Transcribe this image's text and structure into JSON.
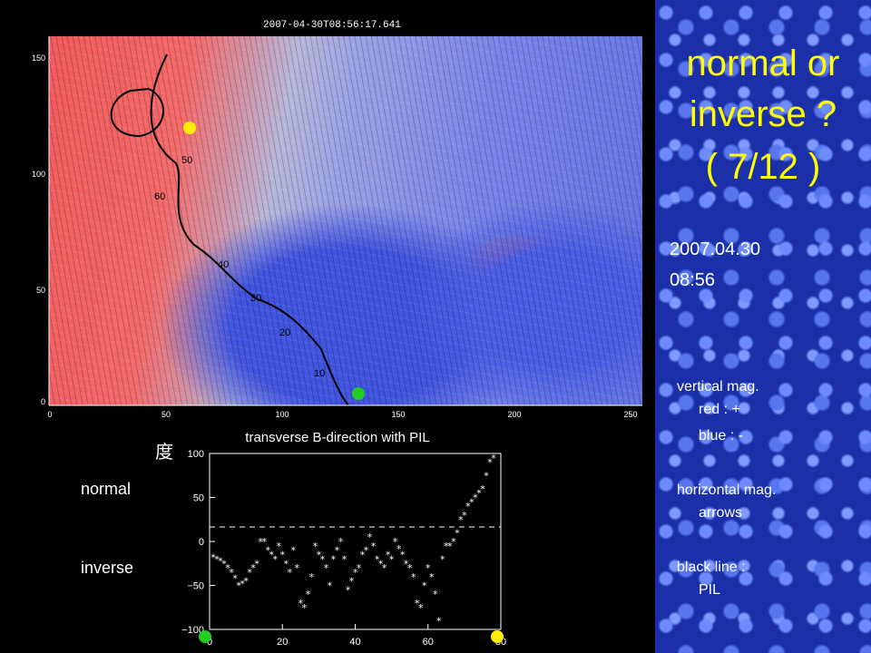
{
  "title": {
    "line1": "normal or",
    "line2": "inverse ?",
    "line3": "( 7/12 )"
  },
  "date": {
    "day": "2007.04.30",
    "time": "08:56"
  },
  "legend": {
    "vertical": "vertical mag.",
    "red": "red : +",
    "blue": "blue : -",
    "horizontal": "horizontal mag.",
    "arrows": "arrows",
    "black_line": "black line :",
    "pil": "PIL"
  },
  "magnetogram": {
    "timestamp": "2007-04-30T08:56:17.641",
    "x_ticks": [
      "0",
      "50",
      "100",
      "150",
      "200",
      "250"
    ],
    "y_ticks": [
      "0",
      "50",
      "100",
      "150"
    ],
    "pil_labels": [
      "50",
      "60",
      "40",
      "30",
      "20",
      "10"
    ]
  },
  "row_labels": {
    "normal": "normal",
    "inverse": "inverse",
    "degree": "度"
  },
  "colors": {
    "positive": "#f05a5a",
    "negative": "#4154df",
    "accent_yellow": "#ffff00",
    "marker_green": "#22cc22",
    "marker_yellow": "#ffee00"
  },
  "chart_data": {
    "type": "scatter",
    "title": "transverse B-direction with PIL",
    "xlabel": "",
    "ylabel": "",
    "xlim": [
      0,
      80
    ],
    "ylim": [
      -100,
      100
    ],
    "x_ticks": [
      "0",
      "20",
      "40",
      "60",
      "80"
    ],
    "y_ticks": [
      "100",
      "50",
      "0",
      "−50",
      "−100"
    ],
    "reference_line": 0,
    "x": [
      1,
      2,
      3,
      4,
      5,
      6,
      7,
      8,
      9,
      10,
      11,
      12,
      13,
      14,
      15,
      16,
      17,
      18,
      19,
      20,
      21,
      22,
      23,
      24,
      25,
      26,
      27,
      28,
      29,
      30,
      31,
      32,
      33,
      34,
      35,
      36,
      37,
      38,
      39,
      40,
      41,
      42,
      43,
      44,
      45,
      46,
      47,
      48,
      49,
      50,
      51,
      52,
      53,
      54,
      55,
      56,
      57,
      58,
      59,
      60,
      61,
      62,
      63,
      64,
      65,
      66,
      67,
      68,
      69,
      70,
      71,
      72,
      73,
      74,
      75,
      76,
      77,
      78
    ],
    "values": [
      -18,
      -20,
      -22,
      -25,
      -30,
      -35,
      -42,
      -50,
      -48,
      -45,
      -35,
      -30,
      -25,
      0,
      0,
      -10,
      -15,
      -20,
      -5,
      -15,
      -25,
      -35,
      -10,
      -30,
      -70,
      -75,
      -60,
      -40,
      -5,
      -15,
      -20,
      -30,
      -50,
      -20,
      -10,
      0,
      -20,
      -55,
      -45,
      -35,
      -30,
      -15,
      -10,
      5,
      -5,
      -20,
      -25,
      -30,
      -15,
      -20,
      0,
      -8,
      -15,
      -25,
      -30,
      -40,
      -70,
      -75,
      -50,
      -30,
      -40,
      -60,
      -90,
      -20,
      -5,
      -5,
      0,
      10,
      25,
      30,
      40,
      45,
      50,
      55,
      60,
      75,
      90,
      95
    ]
  }
}
